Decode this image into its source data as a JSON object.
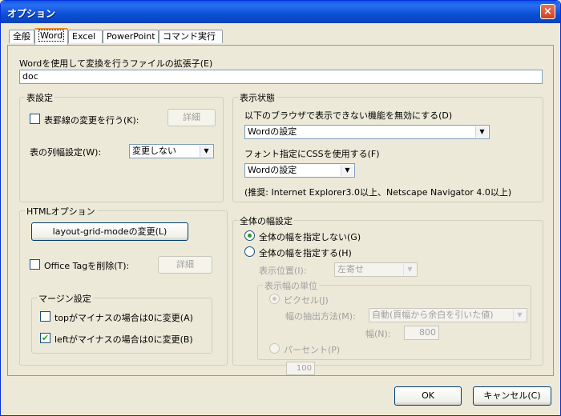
{
  "window": {
    "title": "オプション",
    "close": "×"
  },
  "tabs": [
    "全般",
    "Word",
    "Excel",
    "PowerPoint",
    "コマンド実行"
  ],
  "extension": {
    "label": "Wordを使用して変換を行うファイルの拡張子(E)",
    "value": "doc"
  },
  "table": {
    "group": "表設定",
    "border_change": "表罫線の変更を行う(K):",
    "detail": "詳細",
    "col_width_label": "表の列幅設定(W):",
    "col_width_value": "変更しない"
  },
  "display": {
    "group": "表示状態",
    "disable_label": "以下のブラウザで表示できない機能を無効にする(D)",
    "disable_value": "Wordの設定",
    "css_label": "フォント指定にCSSを使用する(F)",
    "css_value": "Wordの設定",
    "note": "(推奨: Internet Explorer3.0以上、Netscape Navigator 4.0以上)"
  },
  "html": {
    "group": "HTMLオプション",
    "layout_button": "layout-grid-modeの変更(L)",
    "office_tag": "Office Tagを削除(T):",
    "detail": "詳細",
    "margin_group": "マージン設定",
    "top_neg": "topがマイナスの場合は0に変更(A)",
    "left_neg": "leftがマイナスの場合は0に変更(B)"
  },
  "width": {
    "group": "全体の幅設定",
    "no_spec": "全体の幅を指定しない(G)",
    "spec": "全体の幅を指定する(H)",
    "pos_label": "表示位置(I):",
    "pos_value": "左寄せ",
    "unit_group": "表示幅の単位",
    "pixel": "ピクセル(J)",
    "extract_label": "幅の抽出方法(M):",
    "extract_value": "自動(頁幅から余白を引いた値)",
    "width_label": "幅(N):",
    "width_value": "800",
    "percent": "パーセント(P)",
    "percent_value": "100"
  },
  "buttons": {
    "ok": "OK",
    "cancel": "キャンセル(C)"
  }
}
